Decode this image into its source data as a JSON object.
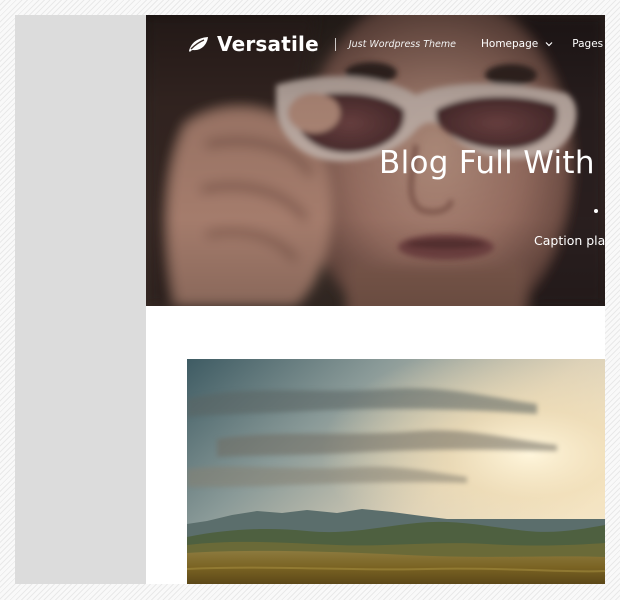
{
  "brand": {
    "name": "Versatile",
    "tagline": "Just Wordpress Theme",
    "icon": "leaf-icon"
  },
  "nav": {
    "items": [
      {
        "label": "Homepage",
        "has_dropdown": true
      },
      {
        "label": "Pages",
        "has_dropdown": false
      }
    ]
  },
  "hero": {
    "title": "Blog Full With",
    "caption": "Caption pla"
  },
  "colors": {
    "side_panel": "#dcdcdc",
    "page_background": "#ffffff",
    "text_on_dark": "#ffffff"
  }
}
